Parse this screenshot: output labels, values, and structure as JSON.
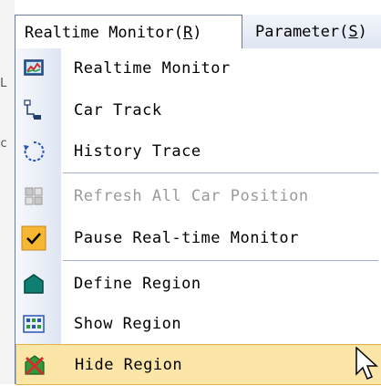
{
  "menubar": {
    "items": [
      {
        "label": "Realtime Monitor",
        "accelerator": "R"
      },
      {
        "label": "Parameter",
        "accelerator": "S"
      }
    ]
  },
  "dropdown": {
    "items": [
      {
        "label": "Realtime Monitor",
        "icon": "monitor-chart-icon",
        "enabled": true
      },
      {
        "label": "Car Track",
        "icon": "track-path-icon",
        "enabled": true
      },
      {
        "label": "History Trace",
        "icon": "circular-trace-icon",
        "enabled": true
      },
      {
        "label": "Refresh All Car Position",
        "icon": "refresh-grid-icon",
        "enabled": false
      },
      {
        "label": "Pause Real-time Monitor",
        "icon": "checkmark-icon",
        "enabled": true,
        "checked": true
      },
      {
        "label": "Define Region",
        "icon": "region-polygon-icon",
        "enabled": true
      },
      {
        "label": "Show Region",
        "icon": "show-region-grid-icon",
        "enabled": true
      },
      {
        "label": "Hide Region",
        "icon": "hide-region-icon",
        "enabled": true,
        "highlighted": true
      }
    ]
  },
  "colors": {
    "menu_hover_bg": "#fbe6a8",
    "menu_hover_border": "#e4b24a",
    "checked_bg": "#f7b733",
    "disabled_text": "#9a9a9a",
    "region_teal": "#0e7f72"
  }
}
